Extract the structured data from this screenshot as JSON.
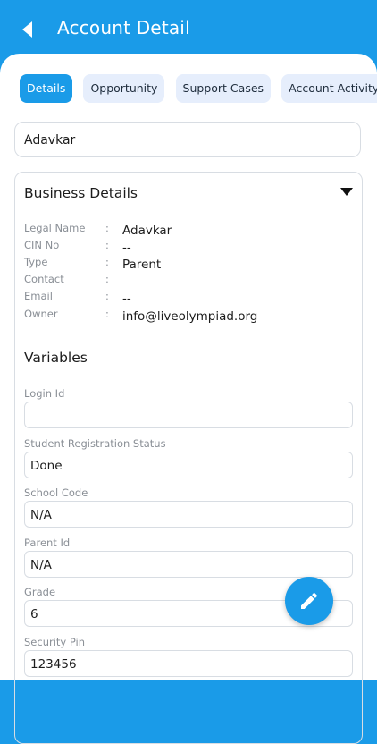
{
  "header": {
    "title": "Account Detail",
    "back_icon": "back-arrow-icon"
  },
  "tabs": [
    {
      "label": "Details",
      "active": true
    },
    {
      "label": "Opportunity",
      "active": false
    },
    {
      "label": "Support Cases",
      "active": false
    },
    {
      "label": "Account Activity",
      "active": false
    }
  ],
  "account_name": "Adavkar",
  "business": {
    "title": "Business Details",
    "rows": [
      {
        "key": "Legal Name",
        "sep": ":",
        "value": "Adavkar"
      },
      {
        "key": "CIN No",
        "sep": ":",
        "value": "--"
      },
      {
        "key": "Type",
        "sep": ":",
        "value": "Parent"
      },
      {
        "key": "Contact",
        "sep": ":",
        "value": ""
      },
      {
        "key": "Email",
        "sep": ":",
        "value": "--"
      },
      {
        "key": "Owner",
        "sep": ":",
        "value": "info@liveolympiad.org"
      }
    ]
  },
  "variables": {
    "title": "Variables",
    "fields": [
      {
        "label": "Login Id",
        "value": ""
      },
      {
        "label": "Student Registration Status",
        "value": "Done"
      },
      {
        "label": "School Code",
        "value": "N/A"
      },
      {
        "label": "Parent Id",
        "value": "N/A"
      },
      {
        "label": "Grade",
        "value": "6"
      },
      {
        "label": "Security Pin",
        "value": "123456"
      }
    ]
  },
  "fab": {
    "icon": "edit-pencil-icon"
  },
  "colors": {
    "primary": "#1a9be8",
    "tab_inactive": "#e6eefc"
  }
}
